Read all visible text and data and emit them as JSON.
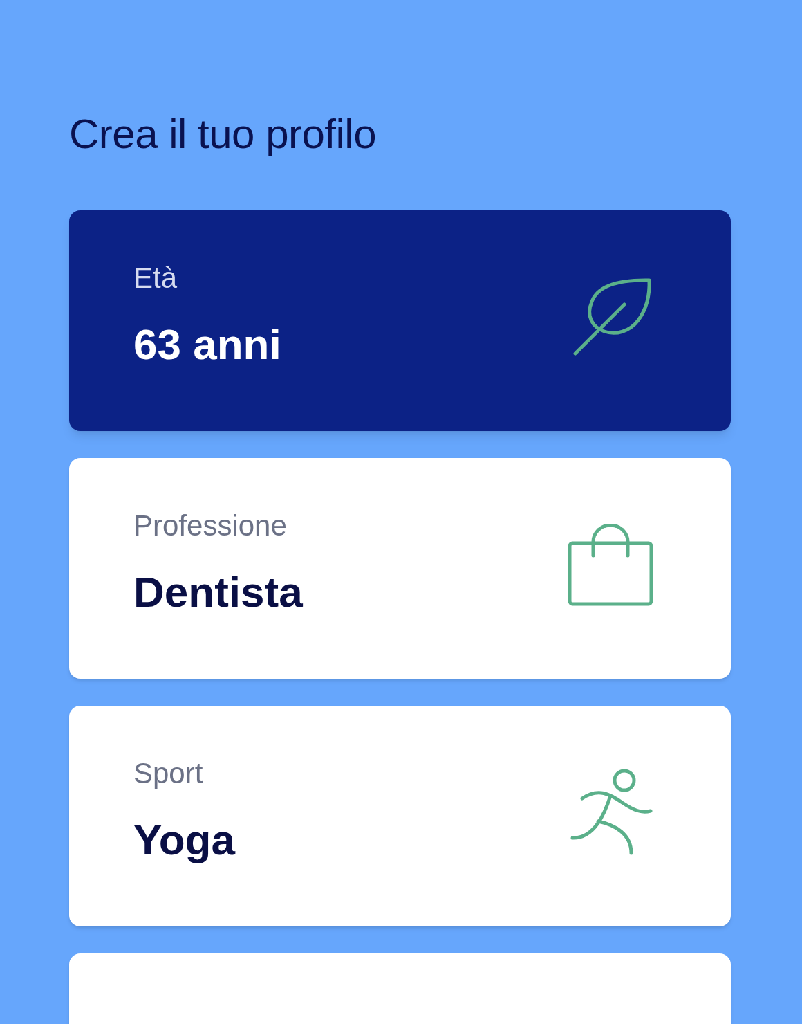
{
  "title": "Crea il tuo profilo",
  "cards": [
    {
      "label": "Età",
      "value": "63 anni",
      "selected": true
    },
    {
      "label": "Professione",
      "value": "Dentista",
      "selected": false
    },
    {
      "label": "Sport",
      "value": "Yoga",
      "selected": false
    }
  ]
}
